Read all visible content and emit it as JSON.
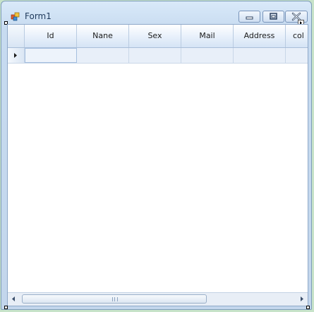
{
  "window": {
    "title": "Form1"
  },
  "grid": {
    "columns": [
      "Id",
      "Nane",
      "Sex",
      "Mail",
      "Address",
      "col"
    ],
    "rows": [
      {
        "cells": [
          "",
          "",
          "",
          "",
          "",
          ""
        ]
      }
    ]
  },
  "icons": {
    "app": "app-icon",
    "minimize": "minimize-icon",
    "maximize": "maximize-icon",
    "close": "close-icon",
    "row_indicator": "arrow-right-icon",
    "scroll_left": "arrow-left-icon",
    "scroll_right": "arrow-right-icon"
  },
  "colors": {
    "frame": "#c7dbf0",
    "header": "#d5e4f5",
    "row": "#e8eff9",
    "background": "#c7e3c9"
  }
}
